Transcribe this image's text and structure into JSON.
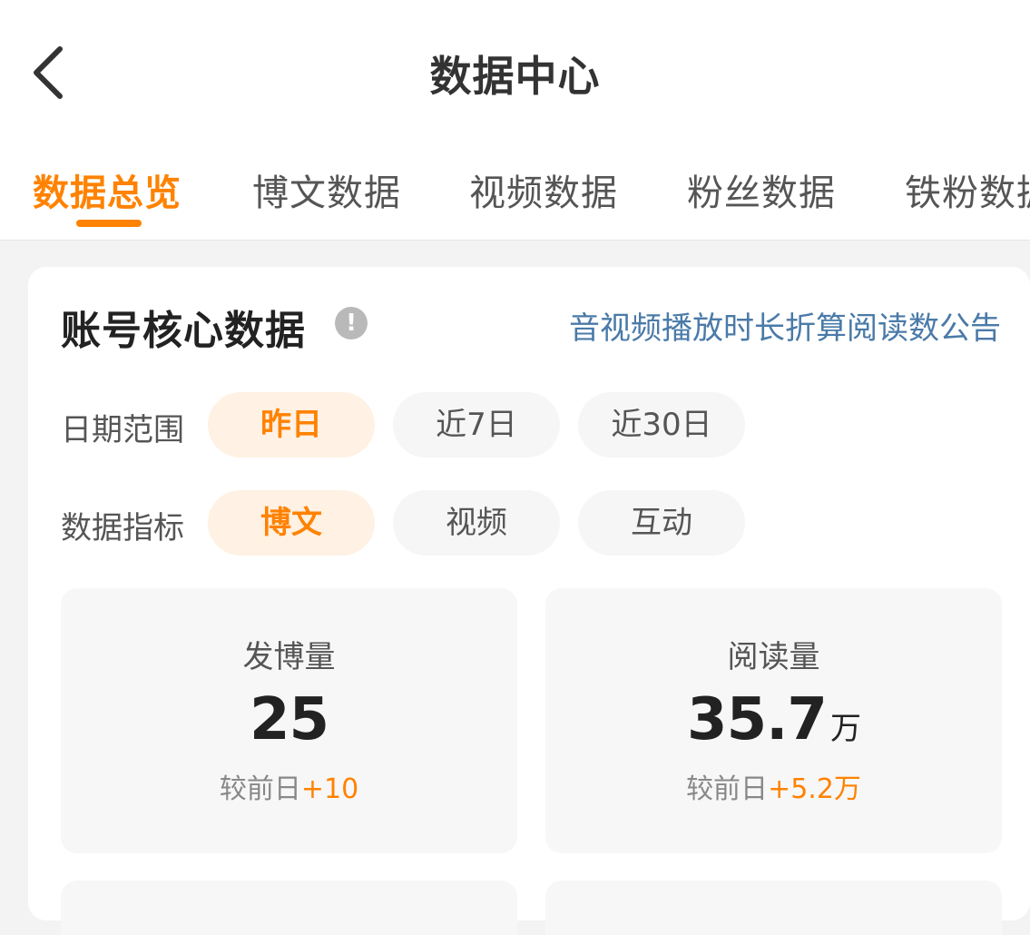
{
  "header": {
    "title": "数据中心"
  },
  "tabs": [
    {
      "label": "数据总览",
      "active": true
    },
    {
      "label": "博文数据",
      "active": false
    },
    {
      "label": "视频数据",
      "active": false
    },
    {
      "label": "粉丝数据",
      "active": false
    },
    {
      "label": "铁粉数据",
      "active": false
    }
  ],
  "card": {
    "title": "账号核心数据",
    "info_icon": "!",
    "notice_link": "音视频播放时长折算阅读数公告",
    "date_filter": {
      "label": "日期范围",
      "options": [
        "昨日",
        "近7日",
        "近30日"
      ],
      "selected": "昨日"
    },
    "metric_filter": {
      "label": "数据指标",
      "options": [
        "博文",
        "视频",
        "互动"
      ],
      "selected": "博文"
    },
    "stats": [
      {
        "label": "发博量",
        "value": "25",
        "unit": "",
        "compare_prefix": "较前日",
        "delta": "+10"
      },
      {
        "label": "阅读量",
        "value": "35.7",
        "unit": "万",
        "compare_prefix": "较前日",
        "delta": "+5.2万"
      }
    ]
  },
  "colors": {
    "accent": "#ff8200",
    "link": "#4a7aa8",
    "active_pill_bg": "#fff1e3"
  },
  "icons": {
    "back": "chevron-left-icon",
    "info": "exclamation-icon"
  }
}
